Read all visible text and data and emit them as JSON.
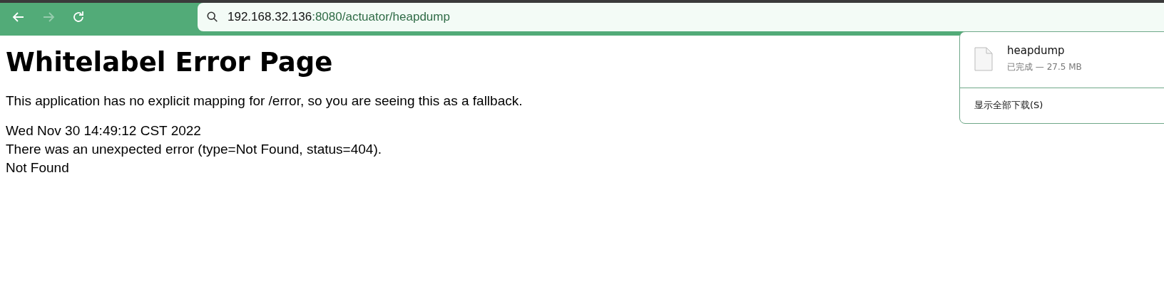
{
  "toolbar": {
    "back": {
      "disabled": false
    },
    "forward": {
      "disabled": true
    },
    "address": {
      "host": "192.168.32.136",
      "path": ":8080/actuator/heapdump"
    }
  },
  "page": {
    "heading": "Whitelabel Error Page",
    "message": "This application has no explicit mapping for /error, so you are seeing this as a fallback.",
    "lines": [
      "Wed Nov 30 14:49:12 CST 2022",
      "There was an unexpected error (type=Not Found, status=404).",
      "Not Found"
    ]
  },
  "downloads": {
    "items": [
      {
        "name": "heapdump",
        "status": "已完成 — 27.5 MB"
      }
    ],
    "show_all": "显示全部下载(S)"
  }
}
